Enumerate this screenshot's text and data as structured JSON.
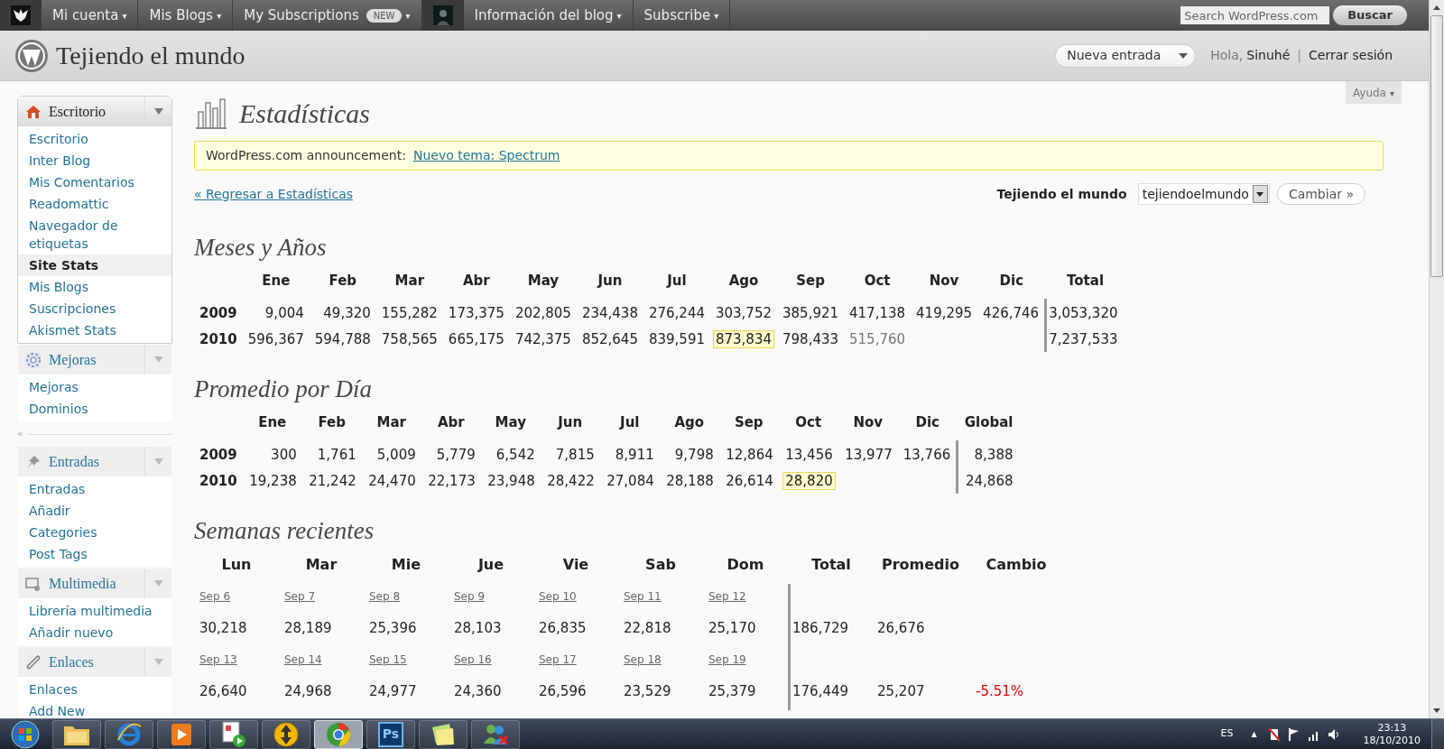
{
  "admin_bar": {
    "items": [
      {
        "kind": "logo"
      },
      {
        "kind": "menu",
        "label": "Mi cuenta",
        "caret": "▾"
      },
      {
        "kind": "menu",
        "label": "Mis Blogs",
        "caret": "▾"
      },
      {
        "kind": "menu",
        "label": "My Subscriptions",
        "badge": "NEW",
        "caret": "▾"
      },
      {
        "kind": "avatar"
      },
      {
        "kind": "menu",
        "label": "Información del blog",
        "caret": "▾"
      },
      {
        "kind": "menu",
        "label": "Subscribe",
        "caret": "▾"
      }
    ],
    "search": {
      "placeholder": "Search WordPress.com"
    },
    "search_button": "Buscar"
  },
  "header": {
    "site_title": "Tejiendo el mundo",
    "new_post_button": "Nueva entrada",
    "greeting": "Hola,",
    "user": "Sinuhé",
    "separator": "|",
    "logout": "Cerrar sesión"
  },
  "help_tab": {
    "label": "Ayuda",
    "caret": "▾"
  },
  "sidebar": {
    "collapse": "«",
    "groups": [
      {
        "title": "Escritorio",
        "kind": "home",
        "expanded": true,
        "items": [
          {
            "label": "Escritorio",
            "selected": false
          },
          {
            "label": "Inter Blog",
            "selected": false
          },
          {
            "label": "Mis Comentarios",
            "selected": false
          },
          {
            "label": "Readomattic",
            "selected": false
          },
          {
            "label": "Navegador de etiquetas",
            "selected": false
          },
          {
            "label": "Site Stats",
            "selected": true
          },
          {
            "label": "Mis Blogs",
            "selected": false
          },
          {
            "label": "Suscripciones",
            "selected": false
          },
          {
            "label": "Akismet Stats",
            "selected": false
          }
        ]
      },
      {
        "title": "Mejoras",
        "kind": "gear",
        "expanded": false,
        "items": [
          {
            "label": "Mejoras",
            "selected": false
          },
          {
            "label": "Dominios",
            "selected": false
          }
        ]
      },
      {
        "title": "Entradas",
        "kind": "pin",
        "expanded": false,
        "items": [
          {
            "label": "Entradas",
            "selected": false
          },
          {
            "label": "Añadir",
            "selected": false
          },
          {
            "label": "Categories",
            "selected": false
          },
          {
            "label": "Post Tags",
            "selected": false
          }
        ]
      },
      {
        "title": "Multimedia",
        "kind": "media",
        "expanded": false,
        "items": [
          {
            "label": "Librería multimedia",
            "selected": false
          },
          {
            "label": "Añadir nuevo",
            "selected": false
          }
        ]
      },
      {
        "title": "Enlaces",
        "kind": "link",
        "expanded": false,
        "items": [
          {
            "label": "Enlaces",
            "selected": false
          },
          {
            "label": "Add New",
            "selected": false
          }
        ]
      }
    ]
  },
  "page": {
    "title": "Estadísticas",
    "announcement": {
      "text": "WordPress.com announcement:",
      "link": "Nuevo tema: Spectrum"
    },
    "back_link": "« Regresar a Estadísticas",
    "blog_label": "Tejiendo el mundo",
    "blog_select": "tejiendoelmundo",
    "change_button": "Cambiar »"
  },
  "months": {
    "title": "Meses y Años",
    "columns": [
      "Ene",
      "Feb",
      "Mar",
      "Abr",
      "May",
      "Jun",
      "Jul",
      "Ago",
      "Sep",
      "Oct",
      "Nov",
      "Dic"
    ],
    "total_column": "Total",
    "rows": [
      {
        "year": "2009",
        "cells": [
          {
            "text": "9,004",
            "highlighted": false,
            "partial": false
          },
          {
            "text": "49,320",
            "highlighted": false,
            "partial": false
          },
          {
            "text": "155,282",
            "highlighted": false,
            "partial": false
          },
          {
            "text": "173,375",
            "highlighted": false,
            "partial": false
          },
          {
            "text": "202,805",
            "highlighted": false,
            "partial": false
          },
          {
            "text": "234,438",
            "highlighted": false,
            "partial": false
          },
          {
            "text": "276,244",
            "highlighted": false,
            "partial": false
          },
          {
            "text": "303,752",
            "highlighted": false,
            "partial": false
          },
          {
            "text": "385,921",
            "highlighted": false,
            "partial": false
          },
          {
            "text": "417,138",
            "highlighted": false,
            "partial": false
          },
          {
            "text": "419,295",
            "highlighted": false,
            "partial": false
          },
          {
            "text": "426,746",
            "highlighted": false,
            "partial": false
          }
        ],
        "total": "3,053,320"
      },
      {
        "year": "2010",
        "cells": [
          {
            "text": "596,367",
            "highlighted": false,
            "partial": false
          },
          {
            "text": "594,788",
            "highlighted": false,
            "partial": false
          },
          {
            "text": "758,565",
            "highlighted": false,
            "partial": false
          },
          {
            "text": "665,175",
            "highlighted": false,
            "partial": false
          },
          {
            "text": "742,375",
            "highlighted": false,
            "partial": false
          },
          {
            "text": "852,645",
            "highlighted": false,
            "partial": false
          },
          {
            "text": "839,591",
            "highlighted": false,
            "partial": false
          },
          {
            "text": "873,834",
            "highlighted": true,
            "partial": false
          },
          {
            "text": "798,433",
            "highlighted": false,
            "partial": false
          },
          {
            "text": "515,760",
            "highlighted": false,
            "partial": true
          }
        ],
        "total": "7,237,533"
      }
    ]
  },
  "daily": {
    "title": "Promedio por Día",
    "columns": [
      "Ene",
      "Feb",
      "Mar",
      "Abr",
      "May",
      "Jun",
      "Jul",
      "Ago",
      "Sep",
      "Oct",
      "Nov",
      "Dic"
    ],
    "total_column": "Global",
    "rows": [
      {
        "year": "2009",
        "cells": [
          {
            "text": "300",
            "highlighted": false,
            "partial": false
          },
          {
            "text": "1,761",
            "highlighted": false,
            "partial": false
          },
          {
            "text": "5,009",
            "highlighted": false,
            "partial": false
          },
          {
            "text": "5,779",
            "highlighted": false,
            "partial": false
          },
          {
            "text": "6,542",
            "highlighted": false,
            "partial": false
          },
          {
            "text": "7,815",
            "highlighted": false,
            "partial": false
          },
          {
            "text": "8,911",
            "highlighted": false,
            "partial": false
          },
          {
            "text": "9,798",
            "highlighted": false,
            "partial": false
          },
          {
            "text": "12,864",
            "highlighted": false,
            "partial": false
          },
          {
            "text": "13,456",
            "highlighted": false,
            "partial": false
          },
          {
            "text": "13,977",
            "highlighted": false,
            "partial": false
          },
          {
            "text": "13,766",
            "highlighted": false,
            "partial": false
          }
        ],
        "total": "8,388"
      },
      {
        "year": "2010",
        "cells": [
          {
            "text": "19,238",
            "highlighted": false,
            "partial": false
          },
          {
            "text": "21,242",
            "highlighted": false,
            "partial": false
          },
          {
            "text": "24,470",
            "highlighted": false,
            "partial": false
          },
          {
            "text": "22,173",
            "highlighted": false,
            "partial": false
          },
          {
            "text": "23,948",
            "highlighted": false,
            "partial": false
          },
          {
            "text": "28,422",
            "highlighted": false,
            "partial": false
          },
          {
            "text": "27,084",
            "highlighted": false,
            "partial": false
          },
          {
            "text": "28,188",
            "highlighted": false,
            "partial": false
          },
          {
            "text": "26,614",
            "highlighted": false,
            "partial": false
          },
          {
            "text": "28,820",
            "highlighted": true,
            "partial": false
          }
        ],
        "total": "24,868"
      }
    ]
  },
  "weeks": {
    "title": "Semanas recientes",
    "columns": [
      "Lun",
      "Mar",
      "Mie",
      "Jue",
      "Vie",
      "Sab",
      "Dom",
      "Total",
      "Promedio",
      "Cambio"
    ],
    "rows": [
      {
        "dates": [
          "Sep 6",
          "Sep 7",
          "Sep 8",
          "Sep 9",
          "Sep 10",
          "Sep 11",
          "Sep 12"
        ],
        "values": [
          "30,218",
          "28,189",
          "25,396",
          "28,103",
          "26,835",
          "22,818",
          "25,170"
        ],
        "total": "186,729",
        "average": "26,676"
      },
      {
        "dates": [
          "Sep 13",
          "Sep 14",
          "Sep 15",
          "Sep 16",
          "Sep 17",
          "Sep 18",
          "Sep 19"
        ],
        "values": [
          "26,640",
          "24,968",
          "24,977",
          "24,360",
          "26,596",
          "23,529",
          "25,379"
        ],
        "total": "176,449",
        "average": "25,207",
        "change": {
          "text": "-5.51%",
          "kind": "negative"
        }
      }
    ]
  },
  "taskbar": {
    "apps": [
      {
        "kind": "folder",
        "selected": false
      },
      {
        "kind": "browser-e",
        "selected": false
      },
      {
        "kind": "player",
        "selected": false
      },
      {
        "kind": "document",
        "selected": false
      },
      {
        "kind": "arrows",
        "selected": false
      },
      {
        "kind": "chrome",
        "selected": true
      },
      {
        "kind": "ps",
        "label": "Ps",
        "selected": false
      },
      {
        "kind": "notes",
        "selected": false
      },
      {
        "kind": "messenger",
        "selected": false
      }
    ],
    "language": "ES",
    "tray_arrow": "▲",
    "time": "23:13",
    "date": "18/10/2010"
  }
}
